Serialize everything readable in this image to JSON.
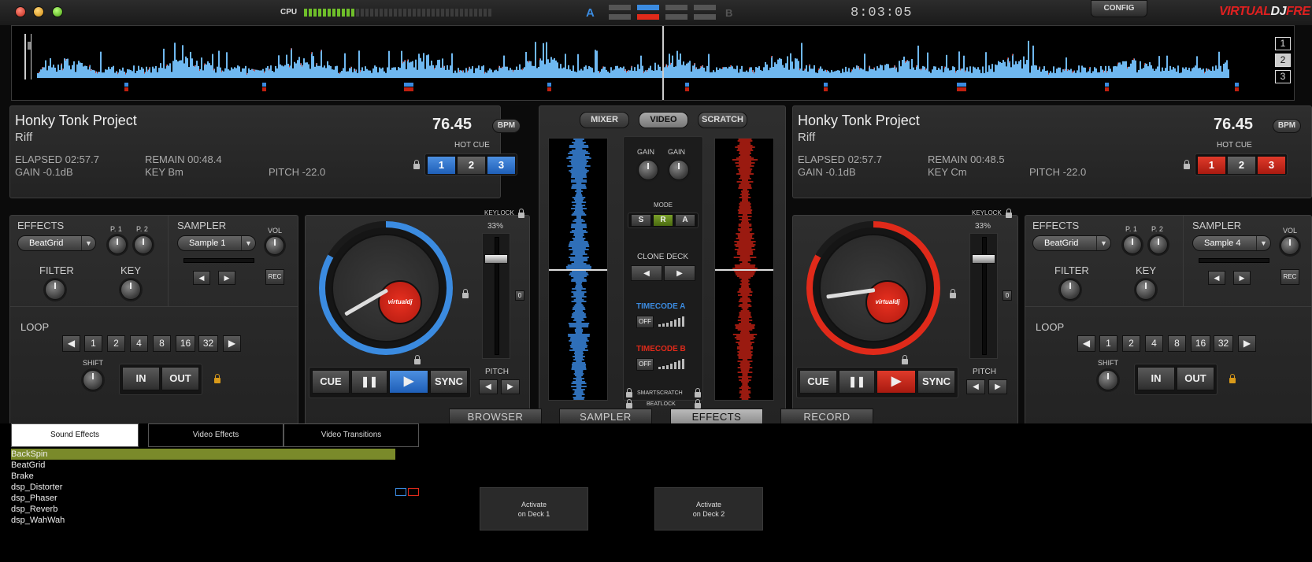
{
  "topbar": {
    "cpu_label": "CPU",
    "cpu_level": 0.27,
    "crossfader_a": "A",
    "crossfader_b": "B",
    "clock": "8:03:05",
    "config_label": "CONFIG",
    "logo_main": "VIRTUAL",
    "logo_dj": "DJ",
    "logo_tail": "FRE"
  },
  "overview": {
    "buttons": [
      "1",
      "2",
      "3"
    ]
  },
  "deckA": {
    "artist": "Honky Tonk Project",
    "title": "Riff",
    "bpm": "76.45",
    "bpm_label": "BPM",
    "elapsed": "ELAPSED 02:57.7",
    "remain": "REMAIN 00:48.4",
    "gain": "GAIN -0.1dB",
    "key": "KEY Bm",
    "pitch": "PITCH -22.0",
    "hotcue_label": "HOT CUE",
    "hotcues": [
      "1",
      "2",
      "3"
    ],
    "effects_label": "EFFECTS",
    "effect": "BeatGrid",
    "p1": "P. 1",
    "p2": "P. 2",
    "filter": "FILTER",
    "key_label": "KEY",
    "sampler_label": "SAMPLER",
    "sample": "Sample 1",
    "vol": "VOL",
    "rec": "REC",
    "loop_label": "LOOP",
    "loops": [
      "1",
      "2",
      "4",
      "8",
      "16",
      "32"
    ],
    "shift": "SHIFT",
    "in": "IN",
    "out": "OUT",
    "keylock": "KEYLOCK",
    "pitch_range": "33%",
    "pitch_label": "PITCH",
    "cue": "CUE",
    "sync": "SYNC",
    "zero": "0",
    "accent": "#3b8be0"
  },
  "deckB": {
    "artist": "Honky Tonk Project",
    "title": "Riff",
    "bpm": "76.45",
    "bpm_label": "BPM",
    "elapsed": "ELAPSED 02:57.7",
    "remain": "REMAIN 00:48.5",
    "gain": "GAIN -0.1dB",
    "key": "KEY Cm",
    "pitch": "PITCH -22.0",
    "hotcue_label": "HOT CUE",
    "hotcues": [
      "1",
      "2",
      "3"
    ],
    "effects_label": "EFFECTS",
    "effect": "BeatGrid",
    "p1": "P. 1",
    "p2": "P. 2",
    "filter": "FILTER",
    "key_label": "KEY",
    "sampler_label": "SAMPLER",
    "sample": "Sample 4",
    "vol": "VOL",
    "rec": "REC",
    "loop_label": "LOOP",
    "loops": [
      "1",
      "2",
      "4",
      "8",
      "16",
      "32"
    ],
    "shift": "SHIFT",
    "in": "IN",
    "out": "OUT",
    "keylock": "KEYLOCK",
    "pitch_range": "33%",
    "pitch_label": "PITCH",
    "cue": "CUE",
    "sync": "SYNC",
    "zero": "0",
    "accent": "#e02a1a"
  },
  "mixer": {
    "tabs": [
      "MIXER",
      "VIDEO",
      "SCRATCH"
    ],
    "gain": "GAIN",
    "mode_label": "MODE",
    "modes": [
      "S",
      "R",
      "A"
    ],
    "clone_deck": "CLONE DECK",
    "timecode_a": "TIMECODE A",
    "timecode_b": "TIMECODE B",
    "off": "OFF",
    "smartscratch": "SMARTSCRATCH",
    "beatlock": "BEATLOCK"
  },
  "bottom_tabs": [
    "BROWSER",
    "SAMPLER",
    "EFFECTS",
    "RECORD"
  ],
  "browser": {
    "subtabs": [
      "Sound Effects",
      "Video Effects",
      "Video Transitions"
    ],
    "effects": [
      "BackSpin",
      "BeatGrid",
      "Brake",
      "dsp_Distorter",
      "dsp_Phaser",
      "dsp_Reverb",
      "dsp_WahWah"
    ],
    "activate_deck1": [
      "Activate",
      "on Deck 1"
    ],
    "activate_deck2": [
      "Activate",
      "on Deck 2"
    ]
  }
}
